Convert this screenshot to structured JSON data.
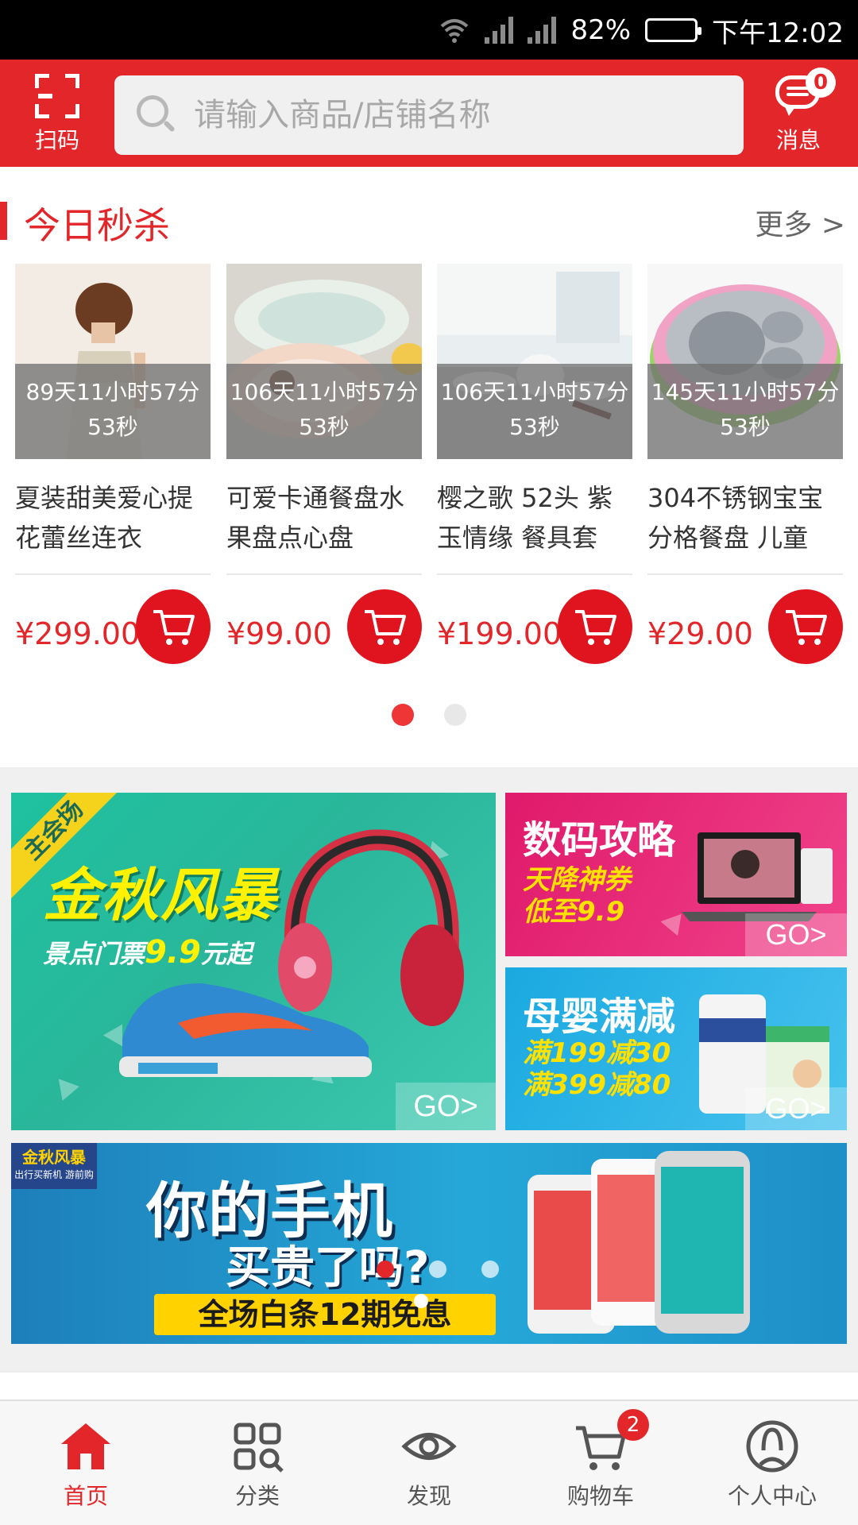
{
  "status_bar": {
    "battery": "82%",
    "time": "下午12:02"
  },
  "header": {
    "scan_label": "扫码",
    "search_placeholder": "请输入商品/店铺名称",
    "message_label": "消息",
    "message_count": "0",
    "accent_color": "#e2262a"
  },
  "flash_sale": {
    "title": "今日秒杀",
    "more": "更多 >",
    "products": [
      {
        "countdown": "89天11小时57分53秒",
        "name": "夏装甜美爱心提花蕾丝连衣",
        "price": "¥299.00"
      },
      {
        "countdown": "106天11小时57分53秒",
        "name": "可爱卡通餐盘水果盘点心盘",
        "price": "¥99.00"
      },
      {
        "countdown": "106天11小时57分53秒",
        "name": "樱之歌 52头 紫玉情缘 餐具套",
        "price": "¥199.00"
      },
      {
        "countdown": "145天11小时57分53秒",
        "name": "304不锈钢宝宝分格餐盘 儿童",
        "price": "¥29.00"
      }
    ],
    "page_indicator": {
      "current": 1,
      "total": 2
    }
  },
  "banners": {
    "main": {
      "tag": "主会场",
      "title": "金秋风暴",
      "subtitle_prefix": "景点门票",
      "subtitle_price": "9.9",
      "subtitle_suffix": "元起",
      "go": "GO>"
    },
    "digital": {
      "title": "数码攻略",
      "line1": "天降神券",
      "line2": "低至9.9",
      "go": "GO>"
    },
    "baby": {
      "title": "母婴满减",
      "line1": "满199减30",
      "line2": "满399减80",
      "go": "GO>"
    },
    "phone": {
      "tag": "金秋风暴",
      "tag_sub": "出行买新机 游前购",
      "line1": "你的手机",
      "line2": "买贵了吗?",
      "line3": "全场白条12期免息"
    }
  },
  "tabbar": {
    "items": [
      {
        "label": "首页",
        "icon": "home-icon"
      },
      {
        "label": "分类",
        "icon": "category-icon"
      },
      {
        "label": "发现",
        "icon": "eye-icon"
      },
      {
        "label": "购物车",
        "icon": "cart-icon",
        "badge": "2"
      },
      {
        "label": "个人中心",
        "icon": "user-icon"
      }
    ],
    "active_index": 0
  }
}
